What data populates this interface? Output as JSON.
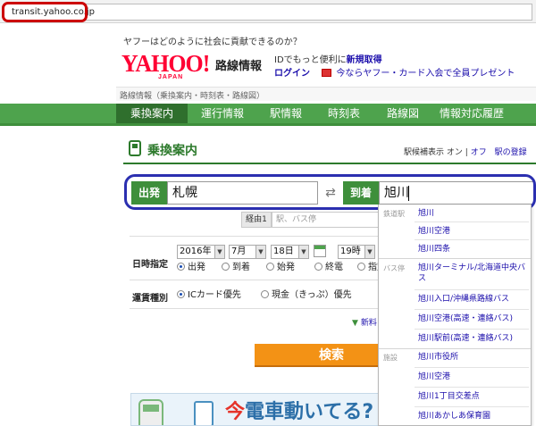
{
  "browser": {
    "url": "transit.yahoo.co.jp"
  },
  "header": {
    "promo": "ヤフーはどのように社会に貢献できるのか？",
    "logo_word": "YAHOO!",
    "logo_sub": "JAPAN",
    "service": "路線情報",
    "id_text": "IDでもっと便利に",
    "id_link": "新規取得",
    "login": "ログイン",
    "card_promo": "今ならヤフー・カード入会で全員プレゼント"
  },
  "breadcrumb": "路線情報（乗換案内・時刻表・路線図）",
  "nav": [
    {
      "label": "乗換案内",
      "active": true
    },
    {
      "label": "運行情報",
      "active": false
    },
    {
      "label": "駅情報",
      "active": false
    },
    {
      "label": "時刻表",
      "active": false
    },
    {
      "label": "路線図",
      "active": false
    },
    {
      "label": "情報対応履歴",
      "active": false
    }
  ],
  "section": {
    "title": "乗換案内",
    "option_label": "駅候補表示",
    "on": "オン",
    "sep": "|",
    "off": "オフ",
    "register": "駅の登録"
  },
  "search": {
    "from_label": "出発",
    "from_value": "札幌",
    "to_label": "到着",
    "to_value": "旭川",
    "via_label": "経由1",
    "via_placeholder": "駅、バス停"
  },
  "datetime": {
    "label": "日時指定",
    "year": "2016年",
    "month": "7月",
    "day": "18日",
    "hour": "19時",
    "options": [
      {
        "label": "出発",
        "selected": true
      },
      {
        "label": "到着",
        "selected": false
      },
      {
        "label": "始発",
        "selected": false
      },
      {
        "label": "終電",
        "selected": false
      },
      {
        "label": "指定",
        "selected": false
      }
    ]
  },
  "fare": {
    "label": "運賃種別",
    "options": [
      {
        "label": "ICカード優先",
        "selected": true
      },
      {
        "label": "現金（きっぷ）優先",
        "selected": false
      }
    ]
  },
  "more_link": "新料",
  "search_button": "検索",
  "banner": {
    "ima": "今",
    "text": "電車動いてる?"
  },
  "suggestions": {
    "station_label": "鉄道駅",
    "stations": [
      "旭川",
      "旭川空港",
      "旭川四条"
    ],
    "bus_label": "バス停",
    "bus_stops": [
      "旭川ターミナル/北海道中央バス",
      "旭川入口/沖縄県路線バス",
      "旭川空港(高速・連絡バス)",
      "旭川駅前(高速・連絡バス)"
    ],
    "facility_label": "施設",
    "facilities": [
      "旭川市役所",
      "旭川空港",
      "旭川1丁目交差点",
      "旭川あかしあ保育園"
    ]
  },
  "colors": {
    "nav_green": "#4ea34d",
    "nav_active": "#2f6f2d",
    "search_orange": "#f39215",
    "highlight_red": "#cc0000",
    "highlight_blue": "#2b2fb0"
  }
}
